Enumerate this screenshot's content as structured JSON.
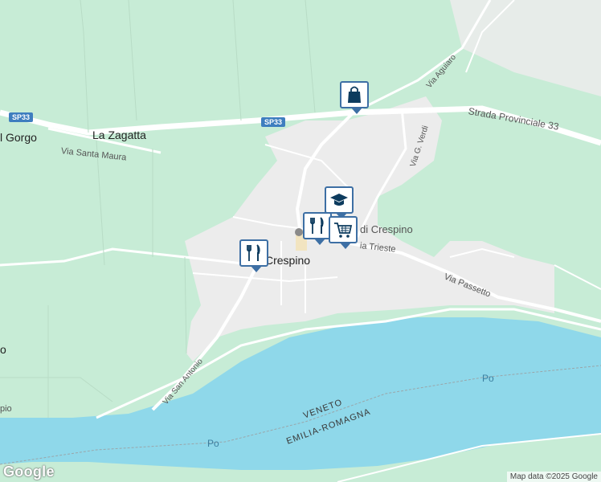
{
  "labels": {
    "la_zagatta": "La Zagatta",
    "gorgo": "l Gorgo",
    "via_santa_maura": "Via Santa Maura",
    "strada_provinciale": "Strada Provinciale 33",
    "via_aguiaro": "Via Aguiaro",
    "via_g_verdi": "Via G. Verdi",
    "crespino_poi": "di Crespino",
    "via_trieste": "ia Trieste",
    "crespino": "Crespino",
    "via_passetto": "Via Passetto",
    "via_san_antonio": "Via San Antonio",
    "left_o": "o",
    "left_pio": "pio",
    "veneto": "VENETO",
    "emilia_romagna": "EMILIA-ROMAGNA",
    "po_upper": "Po",
    "po_lower": "Po"
  },
  "shields": {
    "sp33_left": "SP33",
    "sp33_mid": "SP33"
  },
  "pois": [
    {
      "name": "shopping-bag-icon"
    },
    {
      "name": "school-icon"
    },
    {
      "name": "restaurant-icon"
    },
    {
      "name": "shopping-cart-icon"
    },
    {
      "name": "restaurant-icon"
    }
  ],
  "footer": {
    "google": "Google",
    "attribution": "Map data ©2025 Google"
  },
  "colors": {
    "land": "#c7ecd6",
    "town": "#eeeeee",
    "water": "#8fd8ea",
    "road": "#ffffff",
    "marker": "#3d6fa4"
  }
}
